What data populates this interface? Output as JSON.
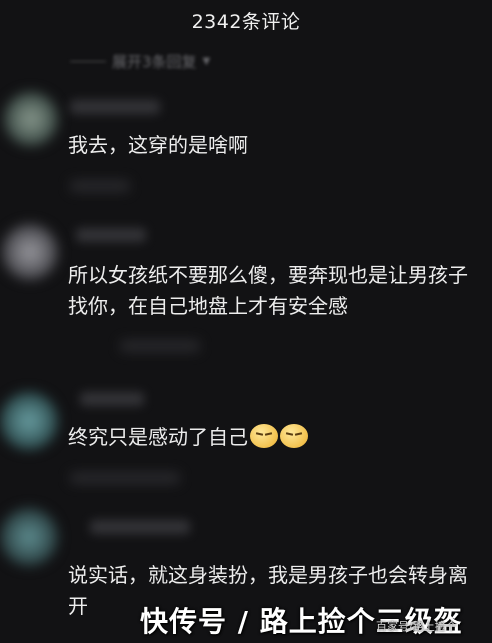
{
  "header": {
    "title": "2342条评论"
  },
  "expand_replies": {
    "label": "展开3条回复"
  },
  "comments": [
    {
      "text": "我去，这穿的是啥啊"
    },
    {
      "text": "所以女孩纸不要那么傻，要奔现也是让男孩子找你，在自己地盘上才有安全感"
    },
    {
      "text": "终究只是感动了自己"
    },
    {
      "text": "说实话，就这身装扮，我是男孩子也会转身离开"
    }
  ],
  "emojis": [
    "frowning-face-icon",
    "frowning-face-icon"
  ],
  "watermark": {
    "main": "快传号 / 路上捡个三级盔",
    "sub": "百家号/路上捡个"
  },
  "colors": {
    "background": "#121214",
    "text": "#ededed",
    "avatar_teal": "#3f6f72",
    "avatar_gray": "#6b6b70"
  }
}
